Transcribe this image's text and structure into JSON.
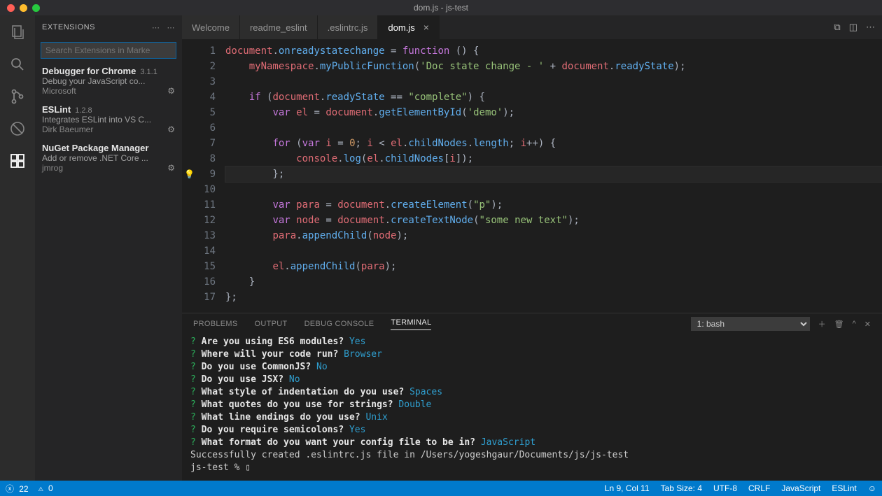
{
  "window": {
    "title": "dom.js - js-test"
  },
  "sidebar": {
    "heading": "EXTENSIONS",
    "search_placeholder": "Search Extensions in Marke",
    "items": [
      {
        "name": "Debugger for Chrome",
        "version": "3.1.1",
        "desc": "Debug your JavaScript co...",
        "publisher": "Microsoft"
      },
      {
        "name": "ESLint",
        "version": "1.2.8",
        "desc": "Integrates ESLint into VS C...",
        "publisher": "Dirk Baeumer"
      },
      {
        "name": "NuGet Package Manager",
        "version": "",
        "desc": "Add or remove .NET Core ...",
        "publisher": "jmrog"
      }
    ]
  },
  "tabs": [
    {
      "label": "Welcome",
      "active": false
    },
    {
      "label": "readme_eslint",
      "active": false
    },
    {
      "label": ".eslintrc.js",
      "active": false
    },
    {
      "label": "dom.js",
      "active": true
    }
  ],
  "code": {
    "lines": [
      "document.onreadystatechange = function () {",
      "    myNamespace.myPublicFunction('Doc state change - ' + document.readyState);",
      "",
      "    if (document.readyState == \"complete\") {",
      "        var el = document.getElementById('demo');",
      "",
      "        for (var i = 0; i < el.childNodes.length; i++) {",
      "            console.log(el.childNodes[i]);",
      "        };",
      "",
      "        var para = document.createElement(\"p\");",
      "        var node = document.createTextNode(\"some new text\");",
      "        para.appendChild(node);",
      "",
      "        el.appendChild(para);",
      "    }",
      "};"
    ]
  },
  "panel": {
    "tabs": [
      "PROBLEMS",
      "OUTPUT",
      "DEBUG CONSOLE",
      "TERMINAL"
    ],
    "dropdown": "1: bash",
    "terminal": [
      {
        "q": "?",
        "prompt": "Are you using ES6 modules?",
        "ans": "Yes"
      },
      {
        "q": "?",
        "prompt": "Where will your code run?",
        "ans": "Browser"
      },
      {
        "q": "?",
        "prompt": "Do you use CommonJS?",
        "ans": "No"
      },
      {
        "q": "?",
        "prompt": "Do you use JSX?",
        "ans": "No"
      },
      {
        "q": "?",
        "prompt": "What style of indentation do you use?",
        "ans": "Spaces"
      },
      {
        "q": "?",
        "prompt": "What quotes do you use for strings?",
        "ans": "Double"
      },
      {
        "q": "?",
        "prompt": "What line endings do you use?",
        "ans": "Unix"
      },
      {
        "q": "?",
        "prompt": "Do you require semicolons?",
        "ans": "Yes"
      },
      {
        "q": "?",
        "prompt": "What format do you want your config file to be in?",
        "ans": "JavaScript"
      }
    ],
    "created_line": "Successfully created .eslintrc.js file in /Users/yogeshgaur/Documents/js/js-test",
    "prompt_line": "js-test %"
  },
  "status": {
    "errors": "22",
    "warnings": "0",
    "cursor": "Ln 9, Col 11",
    "tabsize": "Tab Size: 4",
    "encoding": "UTF-8",
    "eol": "CRLF",
    "lang": "JavaScript",
    "lint": "ESLint"
  }
}
